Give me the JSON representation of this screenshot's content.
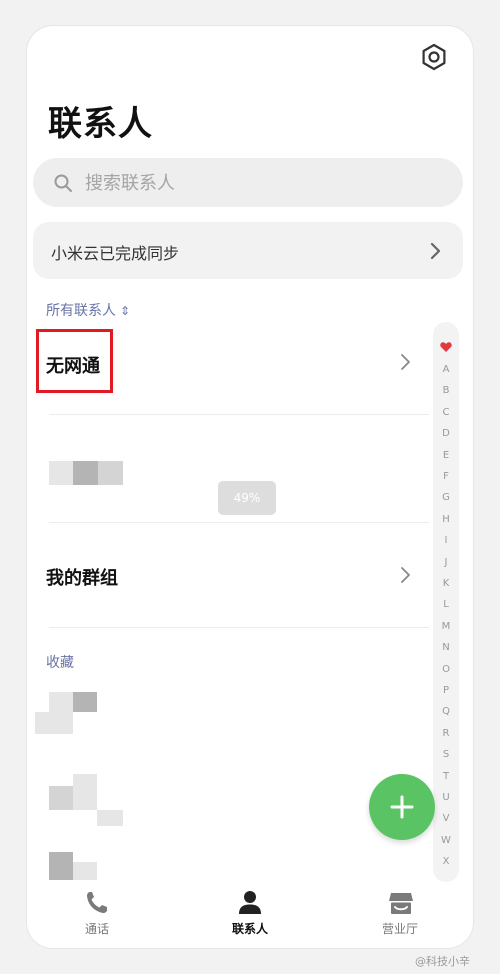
{
  "header": {
    "title": "联系人",
    "settings_icon": "gear-icon"
  },
  "search": {
    "placeholder": "搜索联系人",
    "value": ""
  },
  "sync": {
    "label": "小米云已完成同步"
  },
  "all_contacts": {
    "label": "所有联系人",
    "sort_icon": "⇕"
  },
  "rows": {
    "first_contact": "无网通",
    "groups": "我的群组"
  },
  "favorites": {
    "label": "收藏"
  },
  "toast": {
    "text": "49%"
  },
  "index": {
    "letters": [
      "A",
      "B",
      "C",
      "D",
      "E",
      "F",
      "G",
      "H",
      "I",
      "J",
      "K",
      "L",
      "M",
      "N",
      "O",
      "P",
      "Q",
      "R",
      "S",
      "T",
      "U",
      "V",
      "W",
      "X"
    ]
  },
  "colors": {
    "accent": "#5ac465",
    "section": "#6a73a6",
    "highlight": "#e01b24"
  },
  "tabs": [
    {
      "label": "通话",
      "icon": "phone-icon"
    },
    {
      "label": "联系人",
      "icon": "person-icon",
      "active": true
    },
    {
      "label": "营业厅",
      "icon": "store-icon"
    }
  ],
  "watermark": "@科技小辛"
}
